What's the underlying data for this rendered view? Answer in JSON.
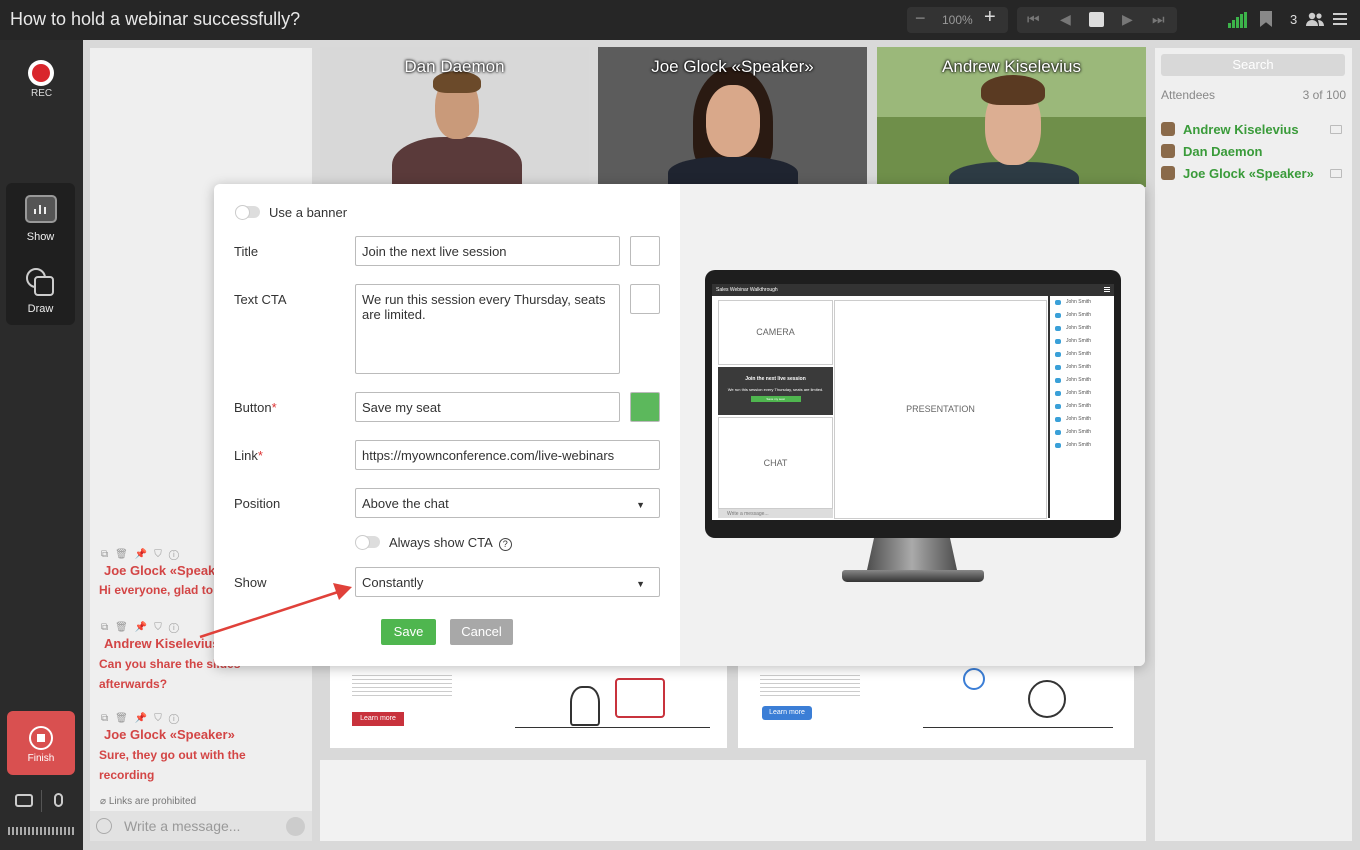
{
  "window": {
    "title": "How to hold a webinar successfully?"
  },
  "toolbar": {
    "zoom": "100%",
    "zoom_minus": "−",
    "zoom_plus": "+",
    "participants_count": "3"
  },
  "left_tools": {
    "rec": "REC",
    "show": "Show",
    "draw": "Draw",
    "finish": "Finish"
  },
  "videos": [
    {
      "name": "Dan Daemon"
    },
    {
      "name": "Joe Glock «Speaker»"
    },
    {
      "name": "Andrew Kiselevius"
    }
  ],
  "attendees_panel": {
    "search_placeholder": "Search",
    "label": "Attendees",
    "count": "3 of 100",
    "items": [
      {
        "name": "Andrew Kiselevius"
      },
      {
        "name": "Dan Daemon"
      },
      {
        "name": "Joe Glock «Speaker»"
      }
    ]
  },
  "chat": {
    "messages": [
      {
        "author": "Joe Glock «Speaker»",
        "text": "Hi everyone, glad to"
      },
      {
        "author": "Andrew Kiselevius",
        "text": "Can you share the slides afterwards?"
      },
      {
        "author": "Joe Glock «Speaker»",
        "text": "Sure, they go out with the recording"
      }
    ],
    "links_note": "Links are prohibited",
    "input_placeholder": "Write a message..."
  },
  "banner_form": {
    "use_banner_label": "Use a banner",
    "title_label": "Title",
    "title_value": "Join the next live session",
    "text_cta_label": "Text CTA",
    "text_cta_value": "We run this session every Thursday, seats are limited.",
    "button_label": "Button",
    "button_value": "Save my seat",
    "link_label": "Link",
    "link_value": "https://myownconference.com/live-webinars",
    "position_label": "Position",
    "position_value": "Above the chat",
    "always_show_label": "Always show CTA",
    "help_glyph": "?",
    "required_mark": "*",
    "show_label": "Show",
    "show_value": "Constantly",
    "save": "Save",
    "cancel": "Cancel",
    "button_color": "#5cb85c"
  },
  "preview": {
    "window_title": "Sales Webinar Walkthrough",
    "camera": "CAMERA",
    "presentation": "PRESENTATION",
    "chat": "CHAT",
    "banner_title": "Join the next live session",
    "banner_text": "We run this session every Thursday, seats are limited.",
    "banner_button": "Save my seat",
    "write_placeholder": "Write a message...",
    "list": [
      "John Smith",
      "John Smith",
      "John Smith",
      "John Smith",
      "John Smith",
      "John Smith",
      "John Smith",
      "John Smith",
      "John Smith",
      "John Smith",
      "John Smith",
      "John Smith"
    ]
  },
  "slides": [
    {
      "button": "Learn more",
      "button_color": "#c8323c"
    },
    {
      "button": "Learn more",
      "button_color": "#3b7ed6"
    }
  ]
}
